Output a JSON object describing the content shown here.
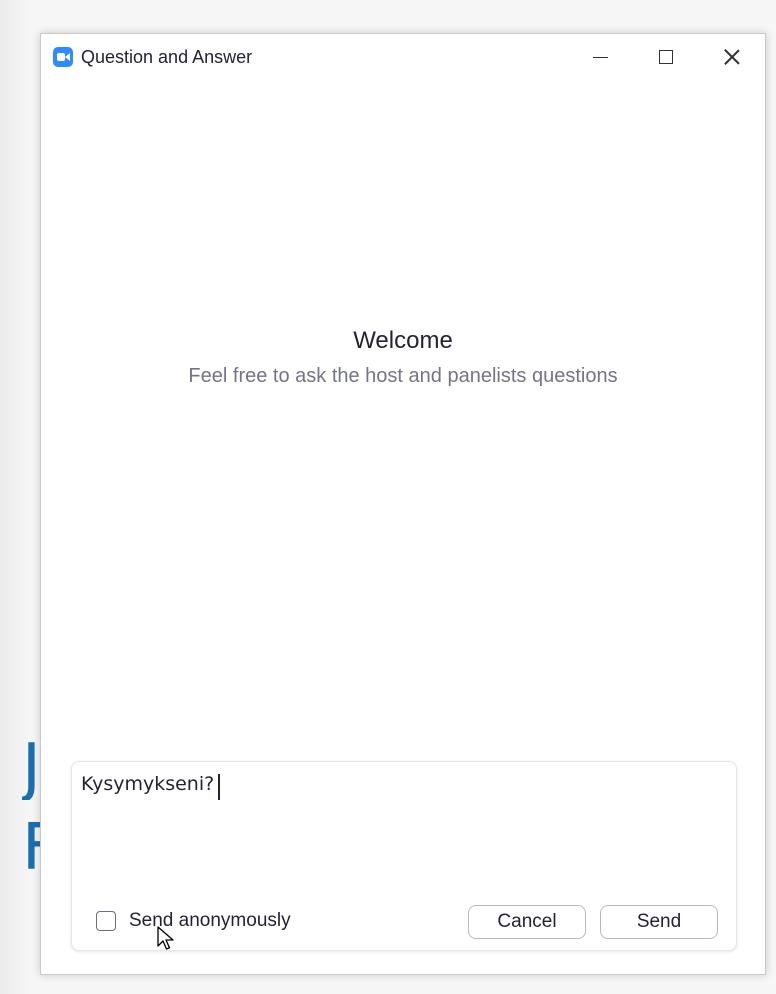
{
  "window": {
    "title": "Question and Answer",
    "app_icon": "zoom-camera-icon",
    "controls": {
      "minimize_icon": "minimize-icon",
      "maximize_icon": "maximize-icon",
      "close_icon": "close-icon"
    }
  },
  "welcome": {
    "title": "Welcome",
    "subtitle": "Feel free to ask the host and panelists questions"
  },
  "composer": {
    "question_value": "Kysymykseni?",
    "send_anonymously": {
      "label": "Send anonymously",
      "checked": false
    },
    "cancel_label": "Cancel",
    "send_label": "Send"
  },
  "colors": {
    "accent": "#2d8cff",
    "text_primary": "#232333",
    "text_secondary": "#747487"
  }
}
